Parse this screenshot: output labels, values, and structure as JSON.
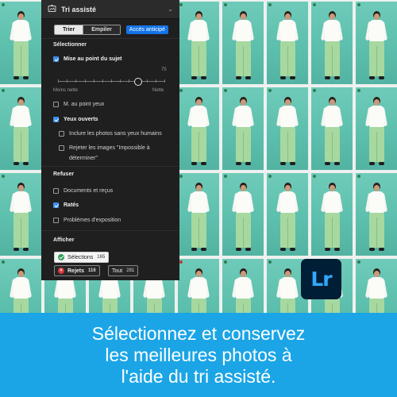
{
  "panel": {
    "title": "Tri assisté",
    "toggle_icon": "chevron-down-icon",
    "header_icon": "assisted-culling-icon",
    "segments": [
      "Trier",
      "Empiler"
    ],
    "active_segment": "Trier",
    "early_access": "Accès anticipé",
    "select_section": "Sélectionner",
    "subject_focus": {
      "label": "Mise au point du sujet",
      "checked": true
    },
    "slider": {
      "value": "75",
      "value_fraction": 0.75,
      "min_label": "Moins nette",
      "max_label": "Nette"
    },
    "eye_focus": {
      "label": "M. au point yeux",
      "checked": false
    },
    "eyes_open": {
      "label": "Yeux ouverts",
      "checked": true
    },
    "include_no_eyes": {
      "label": "Inclure les photos sans yeux humains",
      "checked": false
    },
    "reject_undetermined": {
      "label": "Rejeter les images \"Impossible à",
      "label2": "déterminer\"",
      "checked": false
    },
    "reject_section": "Refuser",
    "documents": {
      "label": "Documents et reçus",
      "checked": false
    },
    "missed": {
      "label": "Ratés",
      "checked": true
    },
    "exposure": {
      "label": "Problèmes d'exposition",
      "checked": false
    },
    "show_section": "Afficher",
    "picks": {
      "label": "Sélections",
      "count": "165"
    },
    "rejects": {
      "label": "Rejets",
      "count": "116"
    },
    "all": {
      "label": "Tout",
      "count": "281"
    }
  },
  "logo": {
    "text": "Lr",
    "color": "#31a8ff",
    "bg": "#001e36"
  },
  "banner": {
    "lines": [
      "Sélectionnez et conservez",
      "les meilleures photos à",
      "l'aide du tri assisté."
    ],
    "bg": "#1ba5e6"
  },
  "colors": {
    "accent": "#1473e6",
    "panel_bg": "#1f1f1f",
    "backdrop": "#5dbfad"
  }
}
